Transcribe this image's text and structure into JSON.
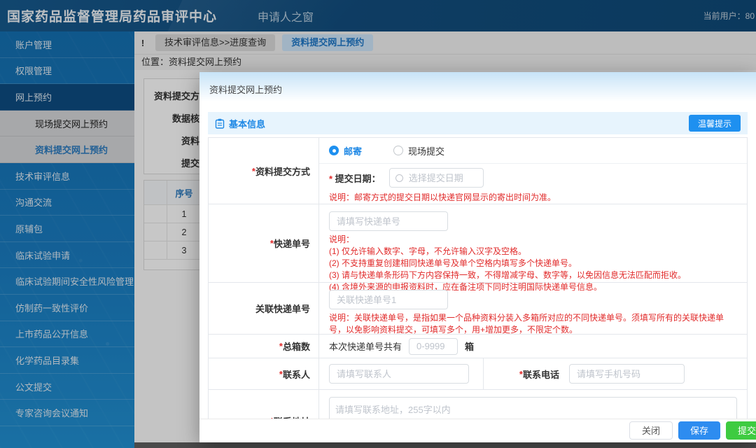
{
  "colors": {
    "accent_blue": "#1e88e5",
    "header_blue": "#124e7f",
    "sidebar_blue": "#1a7dc2",
    "danger_red": "#e12a2a",
    "save_blue": "#2d8cf0",
    "submit_green": "#3ecb41",
    "section_bg": "#e7f4fd"
  },
  "header": {
    "title": "国家药品监督管理局药品审评中心",
    "portal": "申请人之窗",
    "current_user": "当前用户：80"
  },
  "sidebar": {
    "items": [
      "账户管理",
      "权限管理",
      "网上预约",
      "现场提交网上预约",
      "资料提交网上预约",
      "技术审评信息",
      "沟通交流",
      "原辅包",
      "临床试验申请",
      "临床试验期间安全性风险管理",
      "仿制药一致性评价",
      "上市药品公开信息",
      "化学药品目录集",
      "公文提交",
      "专家咨询会议通知"
    ]
  },
  "tabs": {
    "marker": "!",
    "items": [
      "技术审评信息>>进度查询",
      "资料提交网上预约"
    ]
  },
  "breadcrumb": {
    "location": "位置：资料提交网上预约"
  },
  "background": {
    "labels": [
      "资料提交方",
      "数据核",
      "资料",
      "提交"
    ],
    "table": {
      "col_seq": "序号",
      "rows": [
        "1",
        "2",
        "3"
      ]
    }
  },
  "modal": {
    "title": "资料提交网上预约",
    "section": "基本信息",
    "tips_button": "温馨提示",
    "method": {
      "label": "资料提交方式",
      "radio_mail": "邮寄",
      "radio_site": "现场提交",
      "date_label": "提交日期：",
      "date_placeholder": "选择提交日期",
      "note": "说明：邮寄方式的提交日期以快递官网显示的寄出时间为准。"
    },
    "tracking": {
      "label": "快递单号",
      "placeholder": "请填写快递单号",
      "note_title": "说明：",
      "notes": [
        "(1) 仅允许输入数字、字母，不允许输入汉字及空格。",
        "(2) 不支持重复创建相同快递单号及单个空格内填写多个快递单号。",
        "(3) 请与快递单条形码下方内容保持一致，不得增减字母、数字等，以免因信息无法匹配而拒收。",
        "(4) 含境外来源的申报资料时，应在备注项下同时注明国际快递单号信息。"
      ]
    },
    "related": {
      "label": "关联快递单号",
      "placeholder": "关联快递单号1",
      "note": "说明：关联快递单号，是指如果一个品种资料分装入多箱所对应的不同快递单号。须填写所有的关联快递单号，以免影响资料提交，可填写多个，用+增加更多，不限定个数。"
    },
    "boxes": {
      "label": "总箱数",
      "prefix": "本次快递单号共有",
      "placeholder": "0-9999",
      "unit": "箱"
    },
    "contact": {
      "label": "联系人",
      "placeholder": "请填写联系人"
    },
    "phone": {
      "label": "联系电话",
      "placeholder": "请填写手机号码"
    },
    "address": {
      "label": "联系地址",
      "placeholder": "请填写联系地址，255字以内"
    },
    "footer": {
      "close": "关闭",
      "save": "保存",
      "submit": "提交"
    }
  }
}
